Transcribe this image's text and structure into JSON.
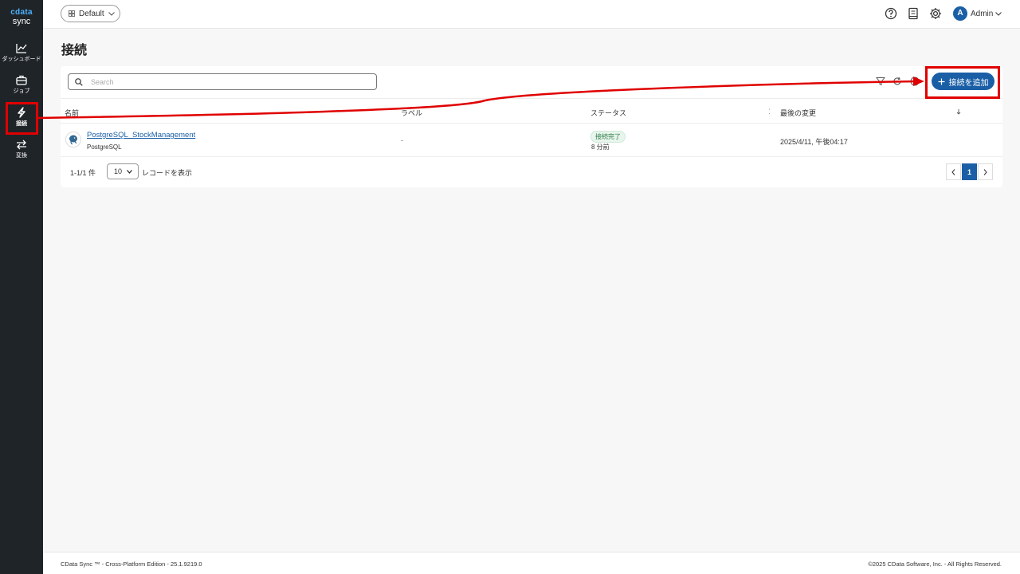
{
  "app": {
    "brand": "cdata",
    "product": "sync"
  },
  "sidebar": {
    "items": [
      {
        "label": "ダッシュボード",
        "icon": "chart-line-icon"
      },
      {
        "label": "ジョブ",
        "icon": "briefcase-icon"
      },
      {
        "label": "接続",
        "icon": "lightning-icon",
        "active": true
      },
      {
        "label": "変換",
        "icon": "transfer-arrows-icon"
      }
    ]
  },
  "topbar": {
    "workspace": "Default",
    "user_initial": "A",
    "user_name": "Admin"
  },
  "page": {
    "title": "接続"
  },
  "toolbar": {
    "search_placeholder": "Search",
    "add_button_label": "接続を追加"
  },
  "table": {
    "columns": [
      "名前",
      "ラベル",
      "ステータス",
      "最後の変更"
    ],
    "rows": [
      {
        "name": "PostgreSQL_StockManagement",
        "type": "PostgreSQL",
        "label": "-",
        "status": "接続完了",
        "status_time": "8 分前",
        "modified": "2025/4/11, 午後04:17"
      }
    ]
  },
  "pagination": {
    "range": "1-1/1 件",
    "page_size": "10",
    "per_page_label": "レコードを表示",
    "current_page": "1"
  },
  "footer": {
    "left": "CData Sync ™ - Cross-Platform Edition - 25.1.9219.0",
    "right": "©2025 CData Software, Inc. - All Rights Reserved."
  },
  "colors": {
    "sidebar_bg": "#1f2429",
    "accent": "#1a5fa6",
    "annotation": "#e00000",
    "status_success": "#2d7a47"
  }
}
